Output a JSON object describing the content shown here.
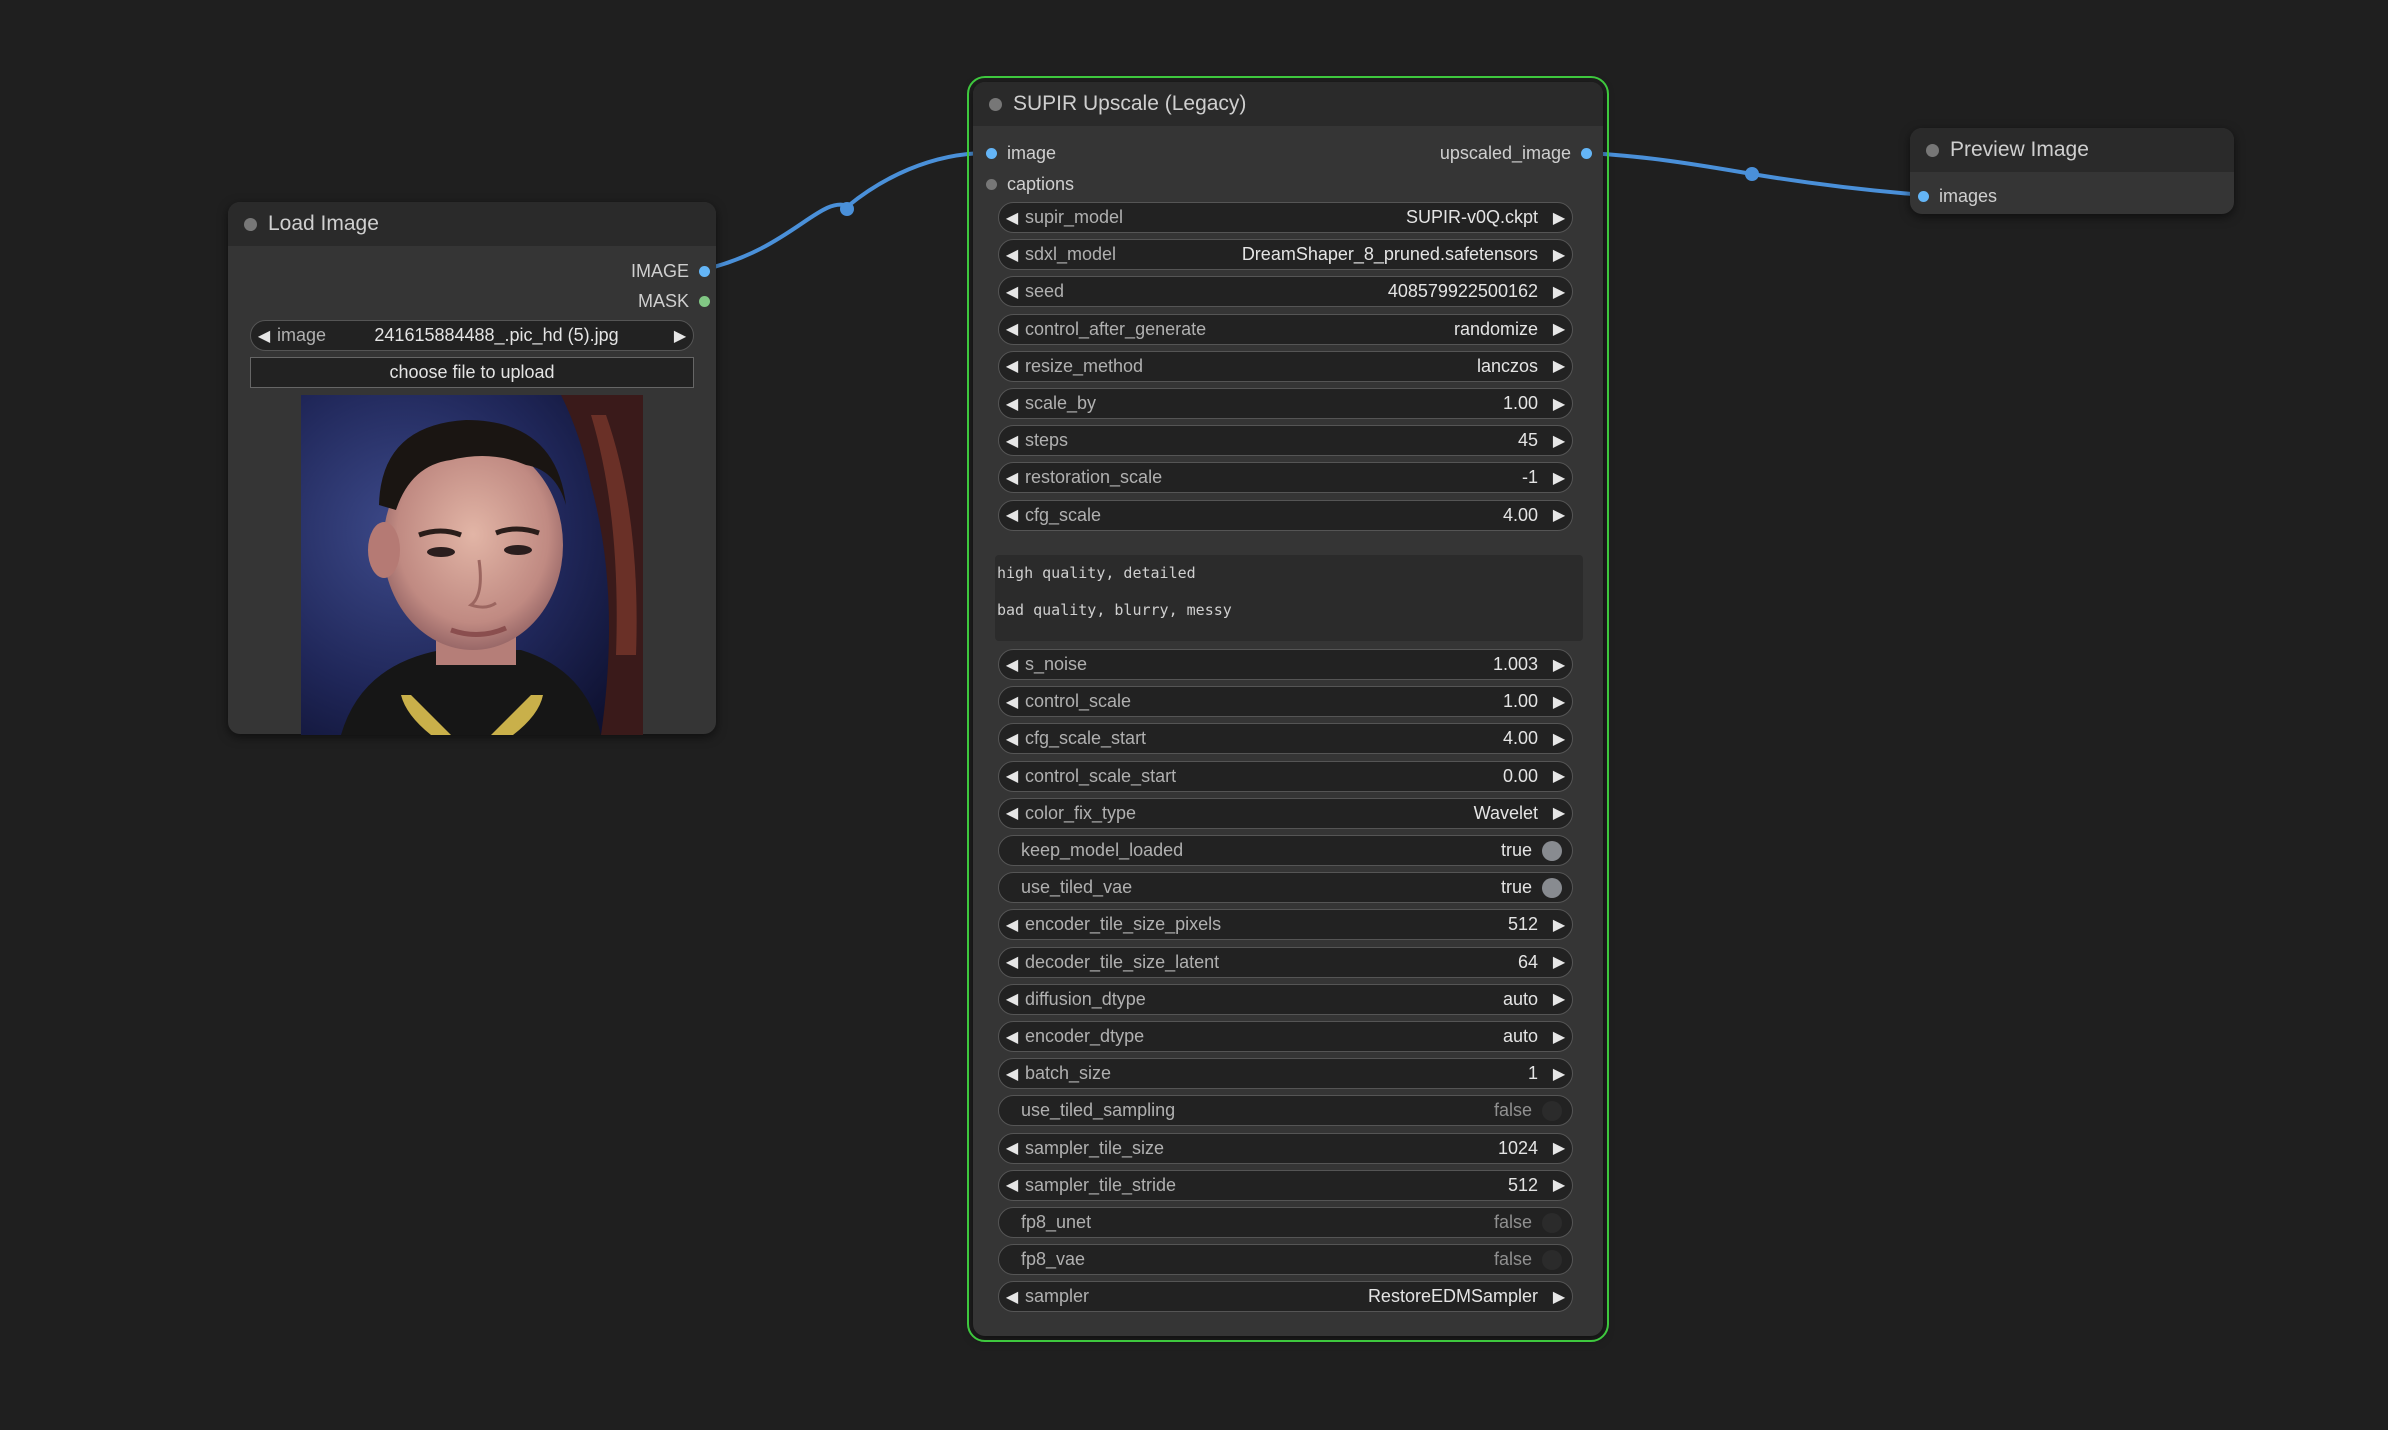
{
  "load_image": {
    "title": "Load Image",
    "outputs": {
      "image": "IMAGE",
      "mask": "MASK"
    },
    "image_widget": {
      "label": "image",
      "value": "241615884488_.pic_hd (5).jpg"
    },
    "upload_button": "choose file to upload"
  },
  "supir": {
    "title": "SUPIR Upscale (Legacy)",
    "inputs": {
      "image": "image",
      "captions": "captions"
    },
    "output": "upscaled_image",
    "widgets_top": [
      {
        "label": "supir_model",
        "value": "SUPIR-v0Q.ckpt"
      },
      {
        "label": "sdxl_model",
        "value": "DreamShaper_8_pruned.safetensors"
      },
      {
        "label": "seed",
        "value": "408579922500162"
      },
      {
        "label": "control_after_generate",
        "value": "randomize"
      },
      {
        "label": "resize_method",
        "value": "lanczos"
      },
      {
        "label": "scale_by",
        "value": "1.00"
      },
      {
        "label": "steps",
        "value": "45"
      },
      {
        "label": "restoration_scale",
        "value": "-1"
      },
      {
        "label": "cfg_scale",
        "value": "4.00"
      }
    ],
    "prompt_positive": "high quality, detailed",
    "prompt_negative": "bad quality, blurry, messy",
    "widgets_bottom": [
      {
        "label": "s_noise",
        "value": "1.003",
        "kind": "combo"
      },
      {
        "label": "control_scale",
        "value": "1.00",
        "kind": "combo"
      },
      {
        "label": "cfg_scale_start",
        "value": "4.00",
        "kind": "combo"
      },
      {
        "label": "control_scale_start",
        "value": "0.00",
        "kind": "combo"
      },
      {
        "label": "color_fix_type",
        "value": "Wavelet",
        "kind": "combo"
      },
      {
        "label": "keep_model_loaded",
        "value": "true",
        "kind": "toggle",
        "on": true
      },
      {
        "label": "use_tiled_vae",
        "value": "true",
        "kind": "toggle",
        "on": true
      },
      {
        "label": "encoder_tile_size_pixels",
        "value": "512",
        "kind": "combo"
      },
      {
        "label": "decoder_tile_size_latent",
        "value": "64",
        "kind": "combo"
      },
      {
        "label": "diffusion_dtype",
        "value": "auto",
        "kind": "combo"
      },
      {
        "label": "encoder_dtype",
        "value": "auto",
        "kind": "combo"
      },
      {
        "label": "batch_size",
        "value": "1",
        "kind": "combo"
      },
      {
        "label": "use_tiled_sampling",
        "value": "false",
        "kind": "toggle",
        "on": false
      },
      {
        "label": "sampler_tile_size",
        "value": "1024",
        "kind": "combo"
      },
      {
        "label": "sampler_tile_stride",
        "value": "512",
        "kind": "combo"
      },
      {
        "label": "fp8_unet",
        "value": "false",
        "kind": "toggle",
        "on": false
      },
      {
        "label": "fp8_vae",
        "value": "false",
        "kind": "toggle",
        "on": false
      },
      {
        "label": "sampler",
        "value": "RestoreEDMSampler",
        "kind": "combo"
      }
    ]
  },
  "preview": {
    "title": "Preview Image",
    "input": "images"
  },
  "colors": {
    "background": "#1f1f1f",
    "node": "#353535",
    "node_header": "#2a2a2a",
    "link": "#4a90d9",
    "selected_outline": "#3ec83e",
    "image_slot": "#64b5f6",
    "mask_slot": "#81c784"
  }
}
